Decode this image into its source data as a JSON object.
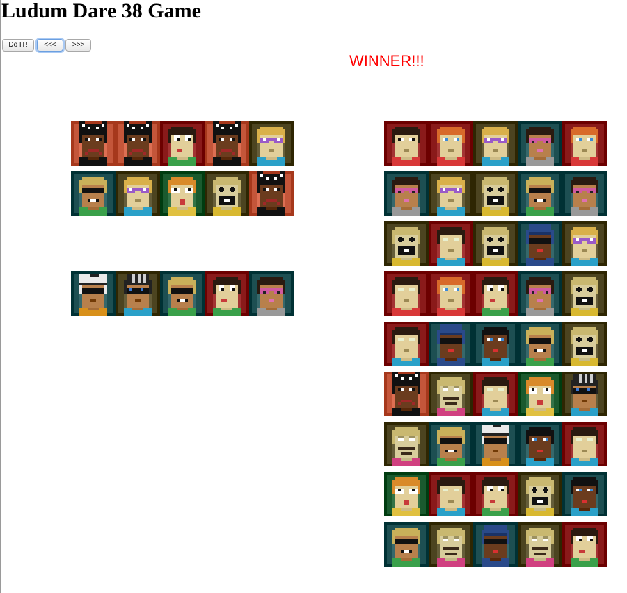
{
  "page": {
    "title": "Ludum Dare 38 Game"
  },
  "toolbar": {
    "buttons": [
      {
        "label": "Do IT!"
      },
      {
        "label": "<<<"
      },
      {
        "label": ">>>"
      }
    ]
  },
  "status": {
    "text": "WINNER!!!",
    "color": "#ff0000"
  },
  "palette": {
    "red": "#8a1a1a",
    "teal": "#1d4f52",
    "olive": "#4c4420",
    "green": "#1a5a2e",
    "orange": "#c4563a",
    "navy": "#233654",
    "skin_light": "#e2cf9a",
    "skin_mid": "#b8804c",
    "skin_dark": "#6b3c1e",
    "skin_pale": "#d8cd9c"
  },
  "left_team": {
    "rows": [
      [
        {
          "bg": "orange",
          "skin": "skin_dark",
          "hair": "#111111",
          "hat": "cat",
          "eyes": "normal",
          "mouth": "frown",
          "shirt": "#111111"
        },
        {
          "bg": "orange",
          "skin": "skin_dark",
          "hair": "#111111",
          "hat": "cat",
          "eyes": "normal",
          "mouth": "frown",
          "shirt": "#111111"
        },
        {
          "bg": "red",
          "skin": "skin_light",
          "hair": "#2a1a10",
          "hat": "none",
          "eyes": "wide",
          "mouth": "smirk",
          "shirt": "#3aa04a"
        },
        {
          "bg": "orange",
          "skin": "skin_dark",
          "hair": "#111111",
          "hat": "cat",
          "eyes": "normal",
          "mouth": "frown",
          "shirt": "#111111"
        },
        {
          "bg": "olive",
          "skin": "skin_light",
          "hair": "#d9b04a",
          "hat": "none",
          "eyes": "glasses-purple",
          "mouth": "flat",
          "shirt": "#2aa0c8"
        }
      ],
      [
        {
          "bg": "teal",
          "skin": "skin_mid",
          "hair": "#c9b05a",
          "hat": "none",
          "eyes": "shades",
          "mouth": "teeth",
          "shirt": "#3aa04a"
        },
        {
          "bg": "olive",
          "skin": "skin_light",
          "hair": "#d9b04a",
          "hat": "none",
          "eyes": "glasses-purple",
          "mouth": "flat",
          "shirt": "#2aa0c8"
        },
        {
          "bg": "green",
          "skin": "skin_light",
          "hair": "#d98a2a",
          "hat": "none",
          "eyes": "dots",
          "mouth": "open",
          "shirt": "#e0c040"
        },
        {
          "bg": "olive",
          "skin": "skin_pale",
          "hair": "#c9b870",
          "hat": "none",
          "eyes": "cross",
          "mouth": "beard",
          "shirt": "#d8b830"
        },
        {
          "bg": "orange",
          "skin": "skin_dark",
          "hair": "#111111",
          "hat": "cat",
          "eyes": "normal",
          "mouth": "frown",
          "shirt": "#111111"
        }
      ],
      [
        {
          "bg": "teal",
          "skin": "skin_mid",
          "hair": "#eaeaea",
          "hat": "cap",
          "eyes": "shades",
          "mouth": "flat",
          "shirt": "#d8901a"
        },
        {
          "bg": "olive",
          "skin": "skin_mid",
          "hair": "#222222",
          "hat": "stripes",
          "eyes": "shades-blue",
          "mouth": "flat",
          "shirt": "#2aa0c8"
        },
        {
          "bg": "teal",
          "skin": "skin_mid",
          "hair": "#c9b05a",
          "hat": "none",
          "eyes": "shades",
          "mouth": "teeth",
          "shirt": "#3aa04a"
        },
        {
          "bg": "red",
          "skin": "skin_light",
          "hair": "#2a1a10",
          "hat": "none",
          "eyes": "wide",
          "mouth": "smirk",
          "shirt": "#3aa04a"
        },
        {
          "bg": "teal",
          "skin": "skin_mid",
          "hair": "#2a1a10",
          "hat": "none",
          "eyes": "glasses-pink",
          "mouth": "pink",
          "shirt": "#999999"
        }
      ]
    ]
  },
  "right_team": {
    "rows": [
      [
        {
          "bg": "red",
          "skin": "skin_light",
          "hair": "#2a1a10",
          "hat": "none",
          "eyes": "normal",
          "mouth": "flat",
          "shirt": "#d83838"
        },
        {
          "bg": "red",
          "skin": "skin_light",
          "hair": "#d86a2a",
          "hat": "none",
          "eyes": "blue",
          "mouth": "flat",
          "shirt": "#d83838"
        },
        {
          "bg": "olive",
          "skin": "skin_light",
          "hair": "#d9b04a",
          "hat": "none",
          "eyes": "glasses-purple",
          "mouth": "flat",
          "shirt": "#2aa0c8"
        },
        {
          "bg": "teal",
          "skin": "skin_mid",
          "hair": "#2a1a10",
          "hat": "none",
          "eyes": "glasses-pink",
          "mouth": "pink",
          "shirt": "#999999"
        },
        {
          "bg": "red",
          "skin": "skin_light",
          "hair": "#d86a2a",
          "hat": "none",
          "eyes": "blue",
          "mouth": "flat",
          "shirt": "#d83838"
        }
      ],
      [
        {
          "bg": "teal",
          "skin": "skin_mid",
          "hair": "#2a1a10",
          "hat": "none",
          "eyes": "glasses-pink",
          "mouth": "pink",
          "shirt": "#999999"
        },
        {
          "bg": "olive",
          "skin": "skin_light",
          "hair": "#d9b04a",
          "hat": "none",
          "eyes": "glasses-purple",
          "mouth": "flat",
          "shirt": "#2aa0c8"
        },
        {
          "bg": "olive",
          "skin": "skin_pale",
          "hair": "#c9b870",
          "hat": "none",
          "eyes": "cross",
          "mouth": "beard",
          "shirt": "#d8b830"
        },
        {
          "bg": "teal",
          "skin": "skin_mid",
          "hair": "#c9b05a",
          "hat": "none",
          "eyes": "shades",
          "mouth": "teeth",
          "shirt": "#3aa04a"
        },
        {
          "bg": "teal",
          "skin": "skin_mid",
          "hair": "#2a1a10",
          "hat": "none",
          "eyes": "glasses-pink",
          "mouth": "pink",
          "shirt": "#999999"
        }
      ],
      [
        {
          "bg": "olive",
          "skin": "skin_pale",
          "hair": "#c9b870",
          "hat": "none",
          "eyes": "cross",
          "mouth": "beard",
          "shirt": "#d8b830"
        },
        {
          "bg": "red",
          "skin": "skin_light",
          "hair": "#2a1a10",
          "hat": "none",
          "eyes": "pale",
          "mouth": "flat",
          "shirt": "#2aa0c8"
        },
        {
          "bg": "olive",
          "skin": "skin_pale",
          "hair": "#c9b870",
          "hat": "none",
          "eyes": "cross",
          "mouth": "beard",
          "shirt": "#d8b830"
        },
        {
          "bg": "teal",
          "skin": "skin_dark",
          "hair": "#2a4a8a",
          "hat": "beanie",
          "eyes": "shades",
          "mouth": "red",
          "shirt": "#2a4a8a"
        },
        {
          "bg": "olive",
          "skin": "skin_light",
          "hair": "#d9b04a",
          "hat": "none",
          "eyes": "glasses-purple",
          "mouth": "flat",
          "shirt": "#2aa0c8"
        }
      ],
      [
        {
          "bg": "red",
          "skin": "skin_light",
          "hair": "#2a1a10",
          "hat": "none",
          "eyes": "pale",
          "mouth": "flat",
          "shirt": "#d83838"
        },
        {
          "bg": "red",
          "skin": "skin_light",
          "hair": "#d86a2a",
          "hat": "none",
          "eyes": "blue",
          "mouth": "flat",
          "shirt": "#d83838"
        },
        {
          "bg": "red",
          "skin": "skin_light",
          "hair": "#2a1a10",
          "hat": "none",
          "eyes": "wide",
          "mouth": "smirk",
          "shirt": "#3aa04a"
        },
        {
          "bg": "teal",
          "skin": "skin_mid",
          "hair": "#2a1a10",
          "hat": "none",
          "eyes": "glasses-pink",
          "mouth": "pink",
          "shirt": "#999999"
        },
        {
          "bg": "olive",
          "skin": "skin_pale",
          "hair": "#c9b870",
          "hat": "none",
          "eyes": "cross",
          "mouth": "beard",
          "shirt": "#d8b830"
        }
      ],
      [
        {
          "bg": "red",
          "skin": "skin_light",
          "hair": "#2a1a10",
          "hat": "none",
          "eyes": "pale",
          "mouth": "flat",
          "shirt": "#2aa0c8"
        },
        {
          "bg": "teal",
          "skin": "skin_dark",
          "hair": "#2a4a8a",
          "hat": "beanie",
          "eyes": "shades",
          "mouth": "red",
          "shirt": "#2a4a8a"
        },
        {
          "bg": "teal",
          "skin": "skin_dark",
          "hair": "#111111",
          "hat": "none",
          "eyes": "blue",
          "mouth": "red",
          "shirt": "#2aa0c8"
        },
        {
          "bg": "teal",
          "skin": "skin_mid",
          "hair": "#c9b05a",
          "hat": "none",
          "eyes": "shades",
          "mouth": "teeth",
          "shirt": "#3aa04a"
        },
        {
          "bg": "olive",
          "skin": "skin_pale",
          "hair": "#c9b870",
          "hat": "none",
          "eyes": "cross",
          "mouth": "beard",
          "shirt": "#d8b830"
        }
      ],
      [
        {
          "bg": "orange",
          "skin": "skin_dark",
          "hair": "#111111",
          "hat": "cat",
          "eyes": "normal",
          "mouth": "frown",
          "shirt": "#111111"
        },
        {
          "bg": "olive",
          "skin": "skin_pale",
          "hair": "#c9b870",
          "hat": "none",
          "eyes": "sleepy",
          "mouth": "mustache",
          "shirt": "#d04080"
        },
        {
          "bg": "red",
          "skin": "skin_light",
          "hair": "#2a1a10",
          "hat": "none",
          "eyes": "pale",
          "mouth": "flat",
          "shirt": "#2aa0c8"
        },
        {
          "bg": "green",
          "skin": "skin_light",
          "hair": "#d98a2a",
          "hat": "none",
          "eyes": "dots",
          "mouth": "open",
          "shirt": "#e0c040"
        },
        {
          "bg": "olive",
          "skin": "skin_mid",
          "hair": "#222222",
          "hat": "stripes",
          "eyes": "shades-blue",
          "mouth": "flat",
          "shirt": "#2aa0c8"
        }
      ],
      [
        {
          "bg": "olive",
          "skin": "skin_pale",
          "hair": "#c9b870",
          "hat": "none",
          "eyes": "sleepy",
          "mouth": "mustache",
          "shirt": "#d04080"
        },
        {
          "bg": "teal",
          "skin": "skin_mid",
          "hair": "#c9b05a",
          "hat": "none",
          "eyes": "shades",
          "mouth": "teeth",
          "shirt": "#3aa04a"
        },
        {
          "bg": "teal",
          "skin": "skin_mid",
          "hair": "#eaeaea",
          "hat": "cap",
          "eyes": "shades",
          "mouth": "flat",
          "shirt": "#d8901a"
        },
        {
          "bg": "teal",
          "skin": "skin_dark",
          "hair": "#111111",
          "hat": "none",
          "eyes": "blue",
          "mouth": "red",
          "shirt": "#2aa0c8"
        },
        {
          "bg": "red",
          "skin": "skin_light",
          "hair": "#2a1a10",
          "hat": "none",
          "eyes": "pale",
          "mouth": "flat",
          "shirt": "#2aa0c8"
        }
      ],
      [
        {
          "bg": "green",
          "skin": "skin_light",
          "hair": "#d98a2a",
          "hat": "none",
          "eyes": "dots",
          "mouth": "open",
          "shirt": "#e0c040"
        },
        {
          "bg": "red",
          "skin": "skin_light",
          "hair": "#2a1a10",
          "hat": "none",
          "eyes": "pale",
          "mouth": "flat",
          "shirt": "#2aa0c8"
        },
        {
          "bg": "red",
          "skin": "skin_light",
          "hair": "#2a1a10",
          "hat": "none",
          "eyes": "wide",
          "mouth": "smirk",
          "shirt": "#3aa04a"
        },
        {
          "bg": "olive",
          "skin": "skin_pale",
          "hair": "#c9b870",
          "hat": "none",
          "eyes": "cross",
          "mouth": "beard",
          "shirt": "#d8b830"
        },
        {
          "bg": "teal",
          "skin": "skin_dark",
          "hair": "#111111",
          "hat": "none",
          "eyes": "blue",
          "mouth": "red",
          "shirt": "#2aa0c8"
        }
      ],
      [
        {
          "bg": "teal",
          "skin": "skin_mid",
          "hair": "#c9b05a",
          "hat": "none",
          "eyes": "shades",
          "mouth": "teeth",
          "shirt": "#3aa04a"
        },
        {
          "bg": "olive",
          "skin": "skin_pale",
          "hair": "#c9b870",
          "hat": "none",
          "eyes": "sleepy",
          "mouth": "mustache",
          "shirt": "#d04080"
        },
        {
          "bg": "teal",
          "skin": "skin_dark",
          "hair": "#2a4a8a",
          "hat": "beanie",
          "eyes": "shades",
          "mouth": "red",
          "shirt": "#2a4a8a"
        },
        {
          "bg": "olive",
          "skin": "skin_pale",
          "hair": "#c9b870",
          "hat": "none",
          "eyes": "sleepy",
          "mouth": "mustache",
          "shirt": "#d04080"
        },
        {
          "bg": "red",
          "skin": "skin_light",
          "hair": "#2a1a10",
          "hat": "none",
          "eyes": "wide",
          "mouth": "smirk",
          "shirt": "#3aa04a"
        }
      ]
    ]
  }
}
